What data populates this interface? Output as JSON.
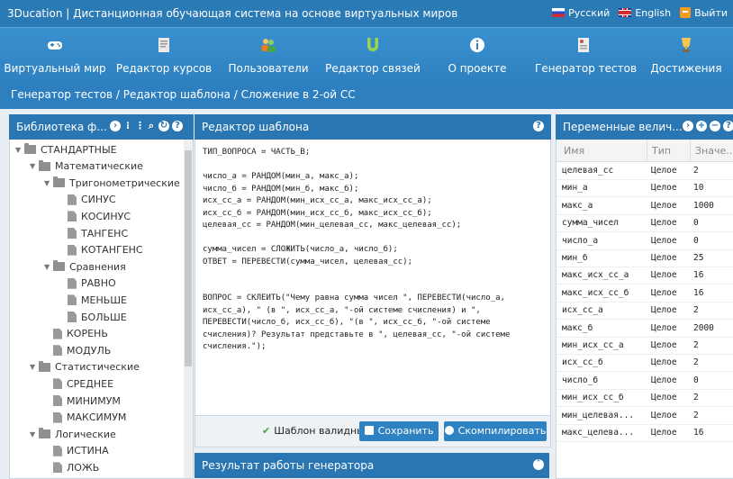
{
  "app_title": "3Ducation | Дистанционная обучающая система на основе виртуальных миров",
  "lang": {
    "ru": "Русский",
    "en": "English",
    "exit": "Выйти"
  },
  "nav": [
    {
      "label": "Виртуальный мир",
      "icon": "gamepad-icon"
    },
    {
      "label": "Редактор курсов",
      "icon": "document-icon"
    },
    {
      "label": "Пользователи",
      "icon": "users-icon"
    },
    {
      "label": "Редактор связей",
      "icon": "magnet-icon"
    },
    {
      "label": "О проекте",
      "icon": "info-icon"
    },
    {
      "label": "Генератор тестов",
      "icon": "test-generator-icon"
    },
    {
      "label": "Достижения",
      "icon": "trophy-icon"
    }
  ],
  "breadcrumb": "Генератор тестов / Редактор шаблона / Сложение в 2-ой СС",
  "library": {
    "title": "Библиотека ф...",
    "tree": [
      {
        "label": "СТАНДАРТНЫЕ",
        "level": 0,
        "kind": "folder",
        "open": true
      },
      {
        "label": "Математические",
        "level": 1,
        "kind": "folder",
        "open": true
      },
      {
        "label": "Тригонометрические",
        "level": 2,
        "kind": "folder",
        "open": true
      },
      {
        "label": "СИНУС",
        "level": 3,
        "kind": "doc"
      },
      {
        "label": "КОСИНУС",
        "level": 3,
        "kind": "doc"
      },
      {
        "label": "ТАНГЕНС",
        "level": 3,
        "kind": "doc"
      },
      {
        "label": "КОТАНГЕНС",
        "level": 3,
        "kind": "doc"
      },
      {
        "label": "Сравнения",
        "level": 2,
        "kind": "folder",
        "open": true
      },
      {
        "label": "РАВНО",
        "level": 3,
        "kind": "doc"
      },
      {
        "label": "МЕНЬШЕ",
        "level": 3,
        "kind": "doc"
      },
      {
        "label": "БОЛЬШЕ",
        "level": 3,
        "kind": "doc"
      },
      {
        "label": "КОРЕНЬ",
        "level": 2,
        "kind": "doc"
      },
      {
        "label": "МОДУЛЬ",
        "level": 2,
        "kind": "doc"
      },
      {
        "label": "Статистические",
        "level": 1,
        "kind": "folder",
        "open": true
      },
      {
        "label": "СРЕДНЕЕ",
        "level": 2,
        "kind": "doc"
      },
      {
        "label": "МИНИМУМ",
        "level": 2,
        "kind": "doc"
      },
      {
        "label": "МАКСИМУМ",
        "level": 2,
        "kind": "doc"
      },
      {
        "label": "Логические",
        "level": 1,
        "kind": "folder",
        "open": true
      },
      {
        "label": "ИСТИНА",
        "level": 2,
        "kind": "doc"
      },
      {
        "label": "ЛОЖЬ",
        "level": 2,
        "kind": "doc"
      }
    ]
  },
  "editor": {
    "title": "Редактор шаблона",
    "code": "ТИП_ВОПРОСА = ЧАСТЬ_В;\n\nчисло_а = РАНДОМ(мин_а, макс_а);\nчисло_б = РАНДОМ(мин_б, макс_б);\nисх_сс_а = РАНДОМ(мин_исх_сс_а, макс_исх_сс_а);\nисх_сс_б = РАНДОМ(мин_исх_сс_б, макс_исх_сс_б);\nцелевая_сс = РАНДОМ(мин_целевая_сс, макс_целевая_сс);\n\nсумма_чисел = СЛОЖИТЬ(число_а, число_б);\nОТВЕТ = ПЕРЕВЕСТИ(сумма_чисел, целевая_сс);\n\n\nВОПРОС = СКЛЕИТЬ(\"Чему равна сумма чисел \", ПЕРЕВЕСТИ(число_а, исх_сс_а), \" (в \", исх_сс_а, \"-ой системе счисления) и \", ПЕРЕВЕСТИ(число_б, исх_сс_б), \"(в \", исх_сс_б, \"-ой системе счисления)? Результат представьте в \", целевая_сс, \"-ой системе счисления.\");",
    "valid_label": "Шаблон валидный",
    "save_label": "Сохранить",
    "compile_label": "Скомпилировать"
  },
  "result": {
    "title": "Результат работы генератора"
  },
  "variables": {
    "title": "Переменные велич...",
    "columns": [
      "Имя",
      "Тип",
      "Значе..."
    ],
    "rows": [
      [
        "целевая_сс",
        "Целое",
        "2"
      ],
      [
        "мин_а",
        "Целое",
        "10"
      ],
      [
        "макс_а",
        "Целое",
        "1000"
      ],
      [
        "сумма_чисел",
        "Целое",
        "0"
      ],
      [
        "число_а",
        "Целое",
        "0"
      ],
      [
        "мин_б",
        "Целое",
        "25"
      ],
      [
        "макс_исх_сс_а",
        "Целое",
        "16"
      ],
      [
        "макс_исх_сс_б",
        "Целое",
        "16"
      ],
      [
        "исх_сс_а",
        "Целое",
        "2"
      ],
      [
        "макс_б",
        "Целое",
        "2000"
      ],
      [
        "мин_исх_сс_а",
        "Целое",
        "2"
      ],
      [
        "исх_сс_б",
        "Целое",
        "2"
      ],
      [
        "число_б",
        "Целое",
        "0"
      ],
      [
        "мин_исх_сс_б",
        "Целое",
        "2"
      ],
      [
        "мин_целевая...",
        "Целое",
        "2"
      ],
      [
        "макс_целева...",
        "Целое",
        "16"
      ]
    ]
  }
}
